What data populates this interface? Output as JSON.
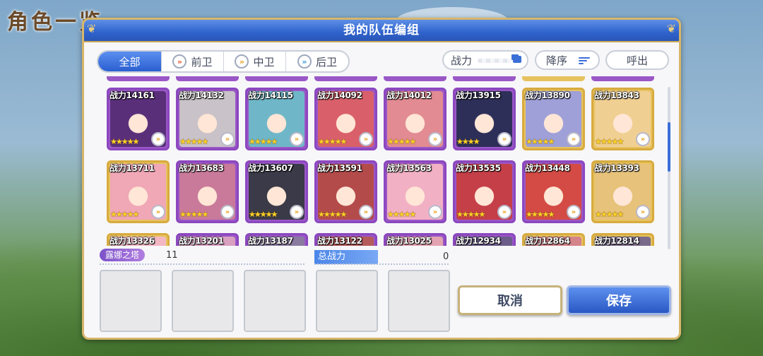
{
  "background": {
    "title": "角色一览"
  },
  "dialog": {
    "title": "我的队伍编组"
  },
  "tabs": [
    {
      "label": "全部",
      "icon": "none",
      "active": true
    },
    {
      "label": "前卫",
      "icon": "front-position-icon",
      "active": false
    },
    {
      "label": "中卫",
      "icon": "middle-position-icon",
      "active": false
    },
    {
      "label": "后卫",
      "icon": "back-position-icon",
      "active": false
    }
  ],
  "toolbar": {
    "power_label": "战力",
    "sort_label": "降序",
    "call_label": "呼出"
  },
  "characters": [
    {
      "power": "战力14161",
      "stars": "★★★★★",
      "frame": "purple",
      "color": "#5a2f7a"
    },
    {
      "power": "战力14132",
      "stars": "★★★★★",
      "frame": "purple",
      "color": "#c9c2c8"
    },
    {
      "power": "战力14115",
      "stars": "★★★★★",
      "frame": "purple",
      "color": "#6fb7c8"
    },
    {
      "power": "战力14092",
      "stars": "★★★★★",
      "frame": "purple",
      "color": "#d9606a"
    },
    {
      "power": "战力14012",
      "stars": "★★★★★",
      "frame": "purple",
      "color": "#e28b92"
    },
    {
      "power": "战力13915",
      "stars": "★★★★",
      "frame": "purple",
      "color": "#2e2f59"
    },
    {
      "power": "战力13890",
      "stars": "★★★★★",
      "frame": "gold",
      "color": "#9fa0d8"
    },
    {
      "power": "战力13843",
      "stars": "★★★★★",
      "frame": "gold",
      "color": "#f0cf92"
    },
    {
      "power": "战力13711",
      "stars": "★★★★★",
      "frame": "gold",
      "color": "#f0a7b6"
    },
    {
      "power": "战力13683",
      "stars": "★★★★★",
      "frame": "purple",
      "color": "#c97a9a"
    },
    {
      "power": "战力13607",
      "stars": "★★★★★",
      "frame": "purple",
      "color": "#3a3a48"
    },
    {
      "power": "战力13591",
      "stars": "★★★★★",
      "frame": "purple",
      "color": "#b44b4b"
    },
    {
      "power": "战力13563",
      "stars": "★★★★★",
      "frame": "purple",
      "color": "#f2b0c5"
    },
    {
      "power": "战力13535",
      "stars": "★★★★★",
      "frame": "purple",
      "color": "#c53f48"
    },
    {
      "power": "战力13448",
      "stars": "★★★★★",
      "frame": "purple",
      "color": "#d34b44"
    },
    {
      "power": "战力13393",
      "stars": "★★★★★",
      "frame": "gold",
      "color": "#e6c27a"
    },
    {
      "power": "战力13326",
      "stars": "",
      "frame": "gold",
      "color": "#f3b7c3"
    },
    {
      "power": "战力13201",
      "stars": "",
      "frame": "purple",
      "color": "#d9a0c0"
    },
    {
      "power": "战力13187",
      "stars": "",
      "frame": "purple",
      "color": "#8a7aa0"
    },
    {
      "power": "战力13122",
      "stars": "",
      "frame": "purple",
      "color": "#b55b5b"
    },
    {
      "power": "战力13025",
      "stars": "",
      "frame": "purple",
      "color": "#e3a3b1"
    },
    {
      "power": "战力12934",
      "stars": "",
      "frame": "purple",
      "color": "#6b5c8a"
    },
    {
      "power": "战力12864",
      "stars": "",
      "frame": "gold",
      "color": "#d4848a"
    },
    {
      "power": "战力12814",
      "stars": "",
      "frame": "gold",
      "color": "#7a6a8a"
    }
  ],
  "team": {
    "name": "露娜之塔",
    "count": "11",
    "total_label": "总战力",
    "total_value": "0"
  },
  "buttons": {
    "cancel": "取消",
    "save": "保存"
  }
}
